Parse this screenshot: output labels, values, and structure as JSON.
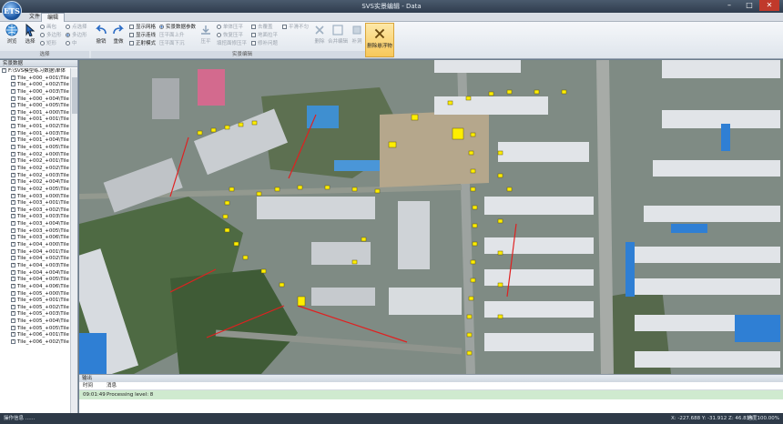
{
  "window": {
    "title": "SVS实景编辑 - Data",
    "logo_text": "ETS"
  },
  "menu": {
    "tabs": [
      "文件",
      "编辑"
    ],
    "active": "编辑"
  },
  "ribbon": {
    "browse": "浏览",
    "select": "选择",
    "select_group": [
      "画包",
      "多边形",
      "矩形"
    ],
    "select_group2": [
      "点选择",
      "多边形",
      "中"
    ],
    "group_select_caption": "选择",
    "undo": "撤销",
    "redo": "重做",
    "show_grid": "显示网格",
    "show_lines": "显示连线",
    "ortho_mode": "正射模式",
    "param_radio": "实景数据参数",
    "param_up": "压平面上升",
    "param_down": "压平面下沉",
    "flatten": "压平",
    "model_flatten": "单体压平",
    "restore_flatten": "恢复压平",
    "flatten_hint": "填挖面修压平",
    "fill_water": "去覆盖",
    "level_flat": "地面拉平",
    "auto_cover": "修补问题",
    "smooth": "平滑不匀",
    "delete": "删除",
    "merge_edit": "合并编辑",
    "patch": "补洞",
    "delete_float": "删除悬浮物",
    "group_edit_caption": "实景编辑"
  },
  "panel": {
    "title": "实景数据",
    "root": "F:\\SVS模型练习数据\\单体",
    "tiles": [
      "Tile_+000_+001\\Tile",
      "Tile_+000_+002\\Tile",
      "Tile_+000_+003\\Tile",
      "Tile_+000_+004\\Tile",
      "Tile_+000_+005\\Tile",
      "Tile_+001_+000\\Tile",
      "Tile_+001_+001\\Tile",
      "Tile_+001_+002\\Tile",
      "Tile_+001_+003\\Tile",
      "Tile_+001_+004\\Tile",
      "Tile_+001_+005\\Tile",
      "Tile_+002_+000\\Tile",
      "Tile_+002_+001\\Tile",
      "Tile_+002_+002\\Tile",
      "Tile_+002_+003\\Tile",
      "Tile_+002_+004\\Tile",
      "Tile_+002_+005\\Tile",
      "Tile_+003_+000\\Tile",
      "Tile_+003_+001\\Tile",
      "Tile_+003_+002\\Tile",
      "Tile_+003_+003\\Tile",
      "Tile_+003_+004\\Tile",
      "Tile_+003_+005\\Tile",
      "Tile_+003_+006\\Tile",
      "Tile_+004_+000\\Tile",
      "Tile_+004_+001\\Tile",
      "Tile_+004_+002\\Tile",
      "Tile_+004_+003\\Tile",
      "Tile_+004_+004\\Tile",
      "Tile_+004_+005\\Tile",
      "Tile_+004_+006\\Tile",
      "Tile_+005_+000\\Tile",
      "Tile_+005_+001\\Tile",
      "Tile_+005_+002\\Tile",
      "Tile_+005_+003\\Tile",
      "Tile_+005_+004\\Tile",
      "Tile_+005_+005\\Tile",
      "Tile_+006_+001\\Tile",
      "Tile_+006_+002\\Tile"
    ]
  },
  "log": {
    "title": "输出",
    "col_time": "时间",
    "col_msg": "消息",
    "rows": [
      {
        "time": "09:01:49",
        "message": "Processing level: 8"
      }
    ]
  },
  "status": {
    "left": "操作信息 ......",
    "coords": "X: -227.688  Y: -31.912  Z: 46.834",
    "progress": "进度100.00%"
  },
  "colors": {
    "accent": "#f8c85a",
    "selection": "#ffee00",
    "edge": "#e02020"
  }
}
